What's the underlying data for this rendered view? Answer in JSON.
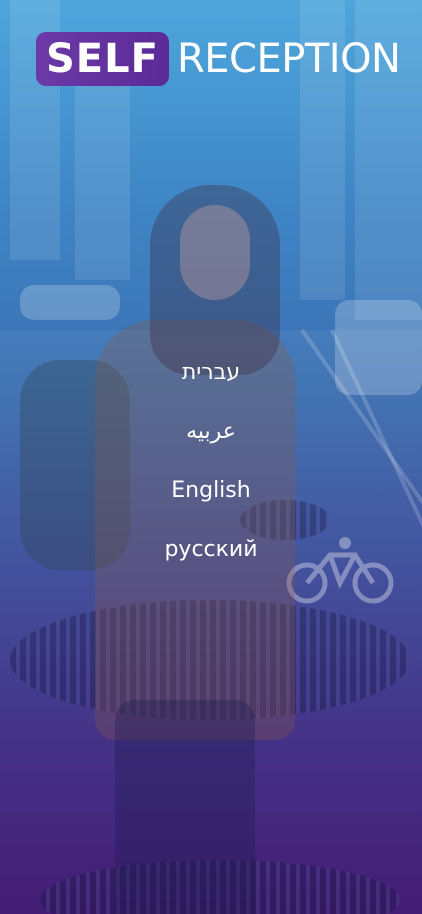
{
  "logo": {
    "self_text": "SELF",
    "reception_text": "RECEPTION"
  },
  "languages": [
    {
      "label": "עברית"
    },
    {
      "label": "عربيه"
    },
    {
      "label": "English"
    },
    {
      "label": "русский"
    }
  ],
  "colors": {
    "gradient_top": "#4ea6dc",
    "gradient_bottom": "#4a1f7e",
    "logo_badge": "#6b3aa8",
    "text": "#ffffff"
  }
}
